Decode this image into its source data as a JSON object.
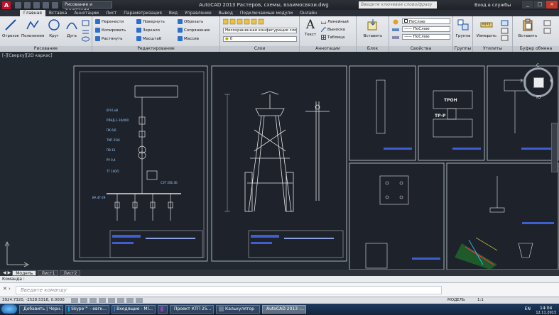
{
  "titlebar": {
    "workspace": "Рисование и аннотации",
    "title": "AutoCAD 2013   Растеров, схемы, взаимосвязи.dwg",
    "search_placeholder": "Введите ключевое слово/фразу",
    "login": "Вход в службы",
    "minimize": "_",
    "maximize": "□",
    "close": "×"
  },
  "ribbon_tabs": [
    "Главная",
    "Вставка",
    "Аннотации",
    "Лист",
    "Параметризация",
    "Вид",
    "Управление",
    "Вывод",
    "Подключаемые модули",
    "Онлайн"
  ],
  "ribbon": {
    "draw": {
      "title": "Рисование",
      "line": "Отрезок",
      "polyline": "Полилиния",
      "circle": "Круг",
      "arc": "Дуга"
    },
    "modify": {
      "title": "Редактирование",
      "items": [
        "Перенести",
        "Повернуть",
        "Обрезать",
        "Копировать",
        "Зеркало",
        "Сопряжение",
        "Растянуть",
        "Масштаб",
        "Массив"
      ]
    },
    "layers": {
      "title": "Слои",
      "state": "Несохраненная конфигурация сло",
      "current": "0"
    },
    "annotations": {
      "title": "Аннотации",
      "text": "Текст",
      "linear": "Линейный",
      "leader": "Выноска",
      "table": "Таблица"
    },
    "block": {
      "title": "Блок",
      "insert": "Вставить"
    },
    "properties": {
      "title": "Свойства",
      "byLayer1": "ПоСлою",
      "byLayer2": "ПоСлою",
      "byLayer3": "ПоСлою"
    },
    "groups": {
      "title": "Группы",
      "group": "Группа"
    },
    "utilities": {
      "title": "Утилиты",
      "measure": "Измерить"
    },
    "clipboard": {
      "title": "Буфер обмена",
      "paste": "Вставить"
    }
  },
  "viewport_label": "[-][Сверху][2D каркас]",
  "compass": {
    "n": "С",
    "w": "З",
    "e": "В",
    "s": "Ю"
  },
  "sheets": {
    "pole_title": "СЭТ 35Б 3Б",
    "labels_left": [
      "ВЛ 6 кВ",
      "РЛНД-1-10/400",
      "ПК 6/6",
      "ТМГ-25/6",
      "ПВ-10",
      "РУ 0,4",
      "ТТ 100/5",
      "ВА 47-29"
    ],
    "grid_tag_a": "ТРОН",
    "grid_tag_b": "ТР-Р"
  },
  "layout_tabs": [
    "Модель",
    "Лист1",
    "Лист2"
  ],
  "command": {
    "history": "Команда :",
    "placeholder": "Введите команду"
  },
  "status": {
    "coords": "3924.7320, -2528.5318, 0.0000",
    "mode": "МОДЕЛЬ",
    "scale": "1:1"
  },
  "taskbar": {
    "items": [
      "Добавить | Черн...",
      "Skype™ - евгк...",
      "Входящие - Ml...",
      "",
      "Проект КТП 25...",
      "Калькулятор",
      "AutoCAD 2013 -..."
    ],
    "lang": "EN",
    "time": "14:04",
    "date": "12.11.2013"
  }
}
